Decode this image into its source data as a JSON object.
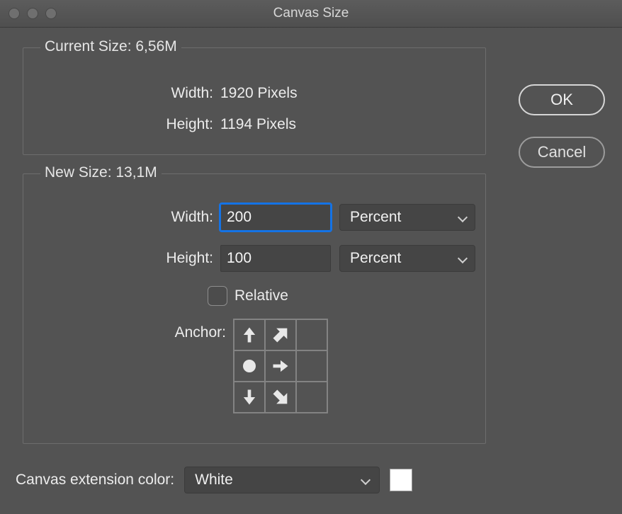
{
  "title": "Canvas Size",
  "buttons": {
    "ok": "OK",
    "cancel": "Cancel"
  },
  "current": {
    "legend": "Current Size: 6,56M",
    "widthLabel": "Width:",
    "widthValue": "1920 Pixels",
    "heightLabel": "Height:",
    "heightValue": "1194 Pixels"
  },
  "new": {
    "legend": "New Size: 13,1M",
    "widthLabel": "Width:",
    "widthValue": "200",
    "widthUnit": "Percent",
    "heightLabel": "Height:",
    "heightValue": "100",
    "heightUnit": "Percent",
    "relativeLabel": "Relative",
    "relativeChecked": false,
    "anchorLabel": "Anchor:",
    "anchorDirections": [
      "n",
      "ne",
      "",
      "center",
      "e",
      "",
      "s",
      "se",
      ""
    ]
  },
  "extension": {
    "label": "Canvas extension color:",
    "value": "White",
    "swatchHex": "#ffffff"
  }
}
